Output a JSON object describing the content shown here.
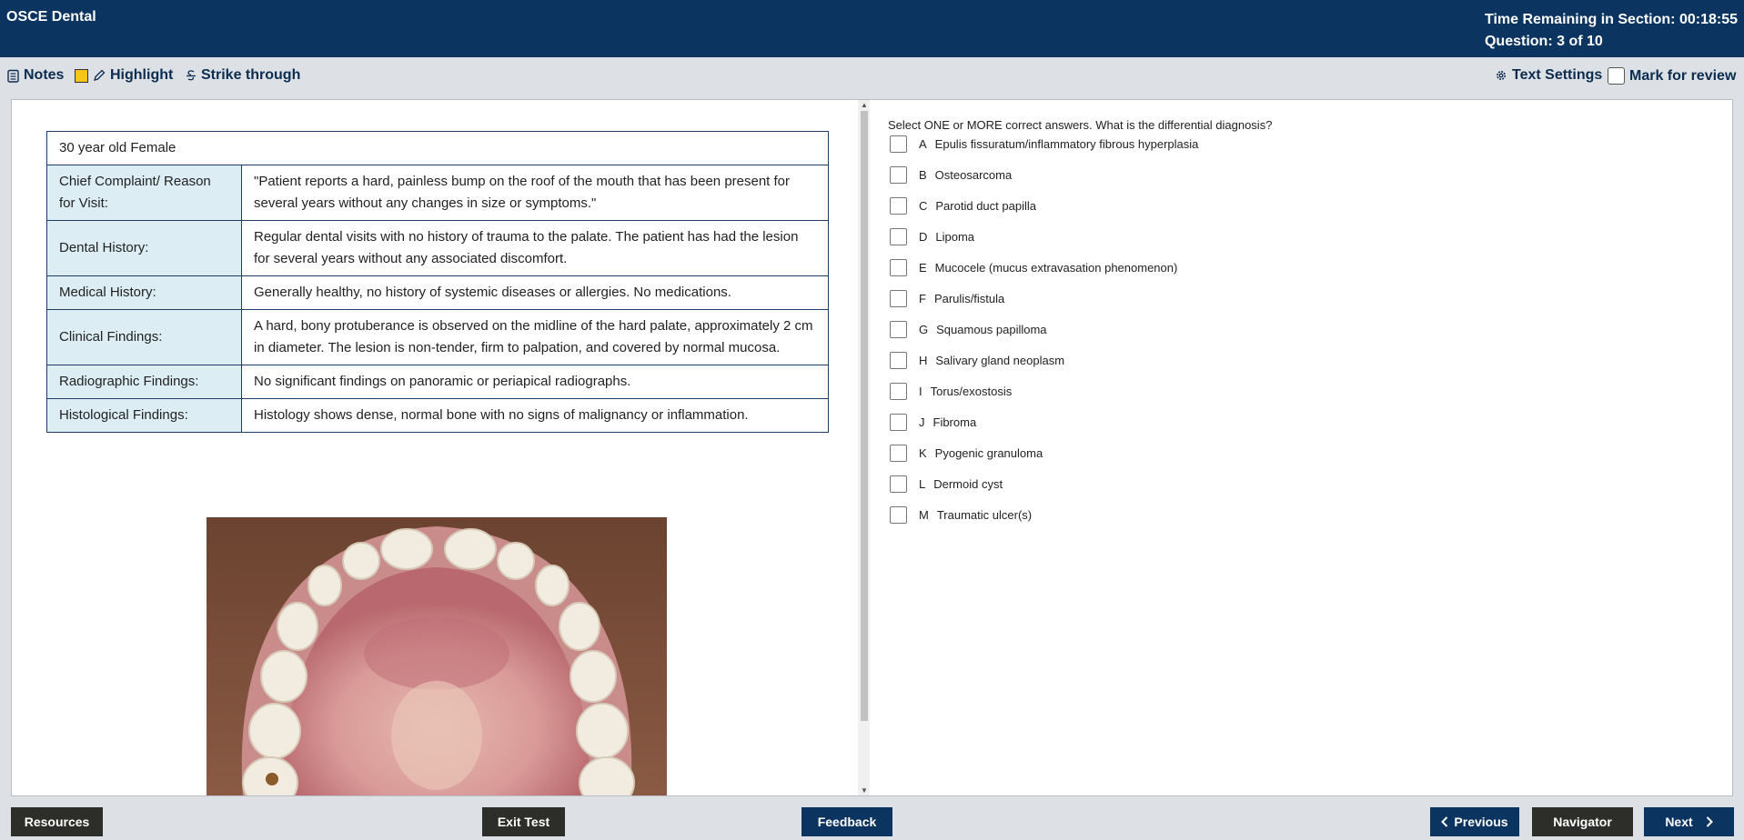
{
  "header": {
    "app_title": "OSCE Dental",
    "time_remaining": "Time Remaining in Section: 00:18:55",
    "question_counter": "Question: 3 of 10"
  },
  "toolbar": {
    "notes_label": "Notes",
    "highlight_label": "Highlight",
    "strike_label": "Strike through",
    "text_settings_label": "Text Settings",
    "mark_review_label": "Mark for review",
    "highlight_color": "#f5c518"
  },
  "case": {
    "header": "30 year old Female",
    "rows": [
      {
        "label": "Chief Complaint/ Reason for Visit:",
        "value": "\"Patient reports a hard, painless bump on the roof of the mouth that has been present for several years without any changes in size or symptoms.\""
      },
      {
        "label": "Dental History:",
        "value": "Regular dental visits with no history of trauma to the palate. The patient has had the lesion for several years without any associated discomfort."
      },
      {
        "label": "Medical History:",
        "value": "Generally healthy, no history of systemic diseases or allergies. No medications."
      },
      {
        "label": "Clinical Findings:",
        "value": "A hard, bony protuberance is observed on the midline of the hard palate, approximately 2 cm in diameter. The lesion is non-tender, firm to palpation, and covered by normal mucosa."
      },
      {
        "label": "Radiographic Findings:",
        "value": "No significant findings on panoramic or periapical radiographs."
      },
      {
        "label": "Histological Findings:",
        "value": "Histology shows dense, normal bone with no signs of malignancy or inflammation."
      }
    ]
  },
  "question": {
    "prompt": "Select ONE or MORE correct answers. What is the differential diagnosis?",
    "options": [
      {
        "letter": "A",
        "text": "Epulis fissuratum/inflammatory fibrous hyperplasia"
      },
      {
        "letter": "B",
        "text": "Osteosarcoma"
      },
      {
        "letter": "C",
        "text": "Parotid duct papilla"
      },
      {
        "letter": "D",
        "text": "Lipoma"
      },
      {
        "letter": "E",
        "text": "Mucocele (mucus extravasation phenomenon)"
      },
      {
        "letter": "F",
        "text": "Parulis/fistula"
      },
      {
        "letter": "G",
        "text": "Squamous papilloma"
      },
      {
        "letter": "H",
        "text": "Salivary gland neoplasm"
      },
      {
        "letter": "I",
        "text": "Torus/exostosis"
      },
      {
        "letter": "J",
        "text": "Fibroma"
      },
      {
        "letter": "K",
        "text": "Pyogenic granuloma"
      },
      {
        "letter": "L",
        "text": "Dermoid cyst"
      },
      {
        "letter": "M",
        "text": "Traumatic ulcer(s)"
      }
    ]
  },
  "footer": {
    "resources_label": "Resources",
    "exit_label": "Exit Test",
    "feedback_label": "Feedback",
    "previous_label": "Previous",
    "navigator_label": "Navigator",
    "next_label": "Next"
  }
}
